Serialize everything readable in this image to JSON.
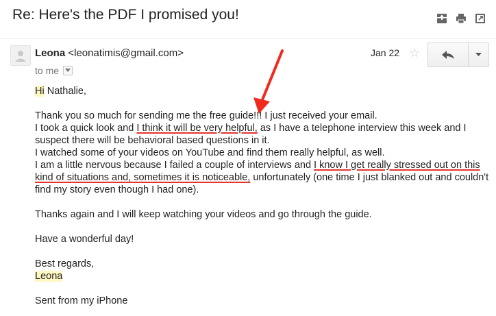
{
  "email": {
    "subject": "Re: Here's the PDF I promised you!",
    "sender_name": "Leona",
    "sender_email": "<leonatimis@gmail.com>",
    "recipient": "to me",
    "date": "Jan 22"
  },
  "icons": {
    "archive": "archive-icon",
    "print": "print-icon",
    "new_window": "new-window-icon",
    "reply": "reply-icon",
    "more": "chevron-down-icon",
    "star": "star-icon",
    "avatar": "avatar-icon"
  },
  "body": {
    "greeting_hi": "Hi",
    "greeting_rest": " Nathalie,",
    "line1": "Thank you so much for sending me the free guide!!! I just received your email.",
    "line2_a": "I took a quick look and ",
    "line2_ul": "I think it will be very helpful,",
    "line2_b": " as I have a telephone interview this week and I suspect there will be behavioral based questions in it.",
    "line3": "I watched some of your videos on YouTube and find them really helpful, as well.",
    "line4_a": "I am a little nervous because I failed a couple of interviews and ",
    "line4_ul": "I know I get really stressed out on this kind of situations and, sometimes it is noticeable,",
    "line4_b": " unfortunately (one time I just blanked out and couldn't find my story even though I had one).",
    "line5": "Thanks again and I will keep watching your videos and go through the guide.",
    "line6": "Have a wonderful day!",
    "closing": "Best regards,",
    "signature": "Leona",
    "footer": "Sent from my iPhone"
  },
  "colors": {
    "highlight": "#fff7c2",
    "underline": "#e3342f",
    "arrow": "#f02a1d"
  }
}
